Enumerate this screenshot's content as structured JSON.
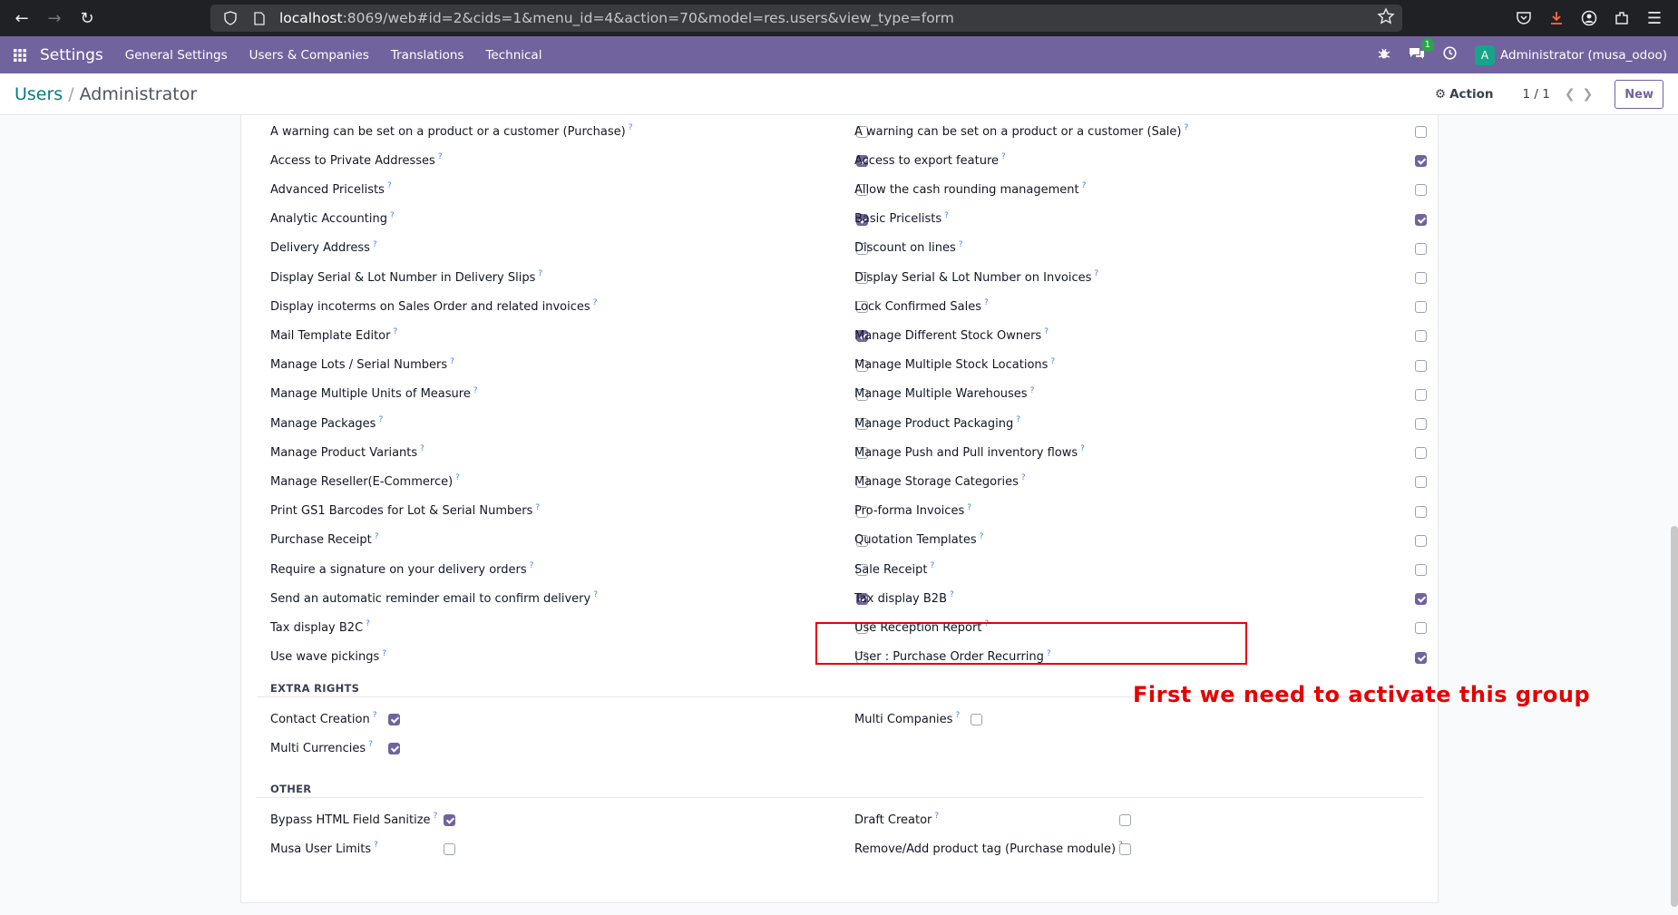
{
  "browser": {
    "url_host": "localhost",
    "url_rest": ":8069/web#id=2&cids=1&menu_id=4&action=70&model=res.users&view_type=form"
  },
  "navbar": {
    "app_name": "Settings",
    "menu": [
      "General Settings",
      "Users & Companies",
      "Translations",
      "Technical"
    ],
    "chat_count": "1",
    "user_initial": "A",
    "user_name": "Administrator (musa_odoo)"
  },
  "control_panel": {
    "breadcrumb_parent": "Users",
    "breadcrumb_current": "Administrator",
    "action_label": "Action",
    "pager": "1 / 1",
    "new_label": "New"
  },
  "permissions": [
    {
      "left": {
        "label": "A warning can be set on a product or a customer (Purchase)",
        "checked": false
      },
      "right": {
        "label": "A warning can be set on a product or a customer (Sale)",
        "checked": false
      }
    },
    {
      "left": {
        "label": "Access to Private Addresses",
        "checked": true
      },
      "right": {
        "label": "Access to export feature",
        "checked": true
      }
    },
    {
      "left": {
        "label": "Advanced Pricelists",
        "checked": false
      },
      "right": {
        "label": "Allow the cash rounding management",
        "checked": false
      }
    },
    {
      "left": {
        "label": "Analytic Accounting",
        "checked": true
      },
      "right": {
        "label": "Basic Pricelists",
        "checked": true
      }
    },
    {
      "left": {
        "label": "Delivery Address",
        "checked": false
      },
      "right": {
        "label": "Discount on lines",
        "checked": false
      }
    },
    {
      "left": {
        "label": "Display Serial & Lot Number in Delivery Slips",
        "checked": false
      },
      "right": {
        "label": "Display Serial & Lot Number on Invoices",
        "checked": false
      }
    },
    {
      "left": {
        "label": "Display incoterms on Sales Order and related invoices",
        "checked": false
      },
      "right": {
        "label": "Lock Confirmed Sales",
        "checked": false
      }
    },
    {
      "left": {
        "label": "Mail Template Editor",
        "checked": true
      },
      "right": {
        "label": "Manage Different Stock Owners",
        "checked": false
      }
    },
    {
      "left": {
        "label": "Manage Lots / Serial Numbers",
        "checked": false
      },
      "right": {
        "label": "Manage Multiple Stock Locations",
        "checked": false
      }
    },
    {
      "left": {
        "label": "Manage Multiple Units of Measure",
        "checked": false
      },
      "right": {
        "label": "Manage Multiple Warehouses",
        "checked": false
      }
    },
    {
      "left": {
        "label": "Manage Packages",
        "checked": false
      },
      "right": {
        "label": "Manage Product Packaging",
        "checked": false
      }
    },
    {
      "left": {
        "label": "Manage Product Variants",
        "checked": false
      },
      "right": {
        "label": "Manage Push and Pull inventory flows",
        "checked": false
      }
    },
    {
      "left": {
        "label": "Manage Reseller(E-Commerce)",
        "checked": false
      },
      "right": {
        "label": "Manage Storage Categories",
        "checked": false
      }
    },
    {
      "left": {
        "label": "Print GS1 Barcodes for Lot & Serial Numbers",
        "checked": false
      },
      "right": {
        "label": "Pro-forma Invoices",
        "checked": false
      }
    },
    {
      "left": {
        "label": "Purchase Receipt",
        "checked": false
      },
      "right": {
        "label": "Quotation Templates",
        "checked": false
      }
    },
    {
      "left": {
        "label": "Require a signature on your delivery orders",
        "checked": false
      },
      "right": {
        "label": "Sale Receipt",
        "checked": false
      }
    },
    {
      "left": {
        "label": "Send an automatic reminder email to confirm delivery",
        "checked": true
      },
      "right": {
        "label": "Tax display B2B",
        "checked": true
      }
    },
    {
      "left": {
        "label": "Tax display B2C",
        "checked": false
      },
      "right": {
        "label": "Use Reception Report",
        "checked": false
      }
    },
    {
      "left": {
        "label": "Use wave pickings",
        "checked": false
      },
      "right": {
        "label": "User : Purchase Order Recurring",
        "checked": true
      }
    }
  ],
  "extra_rights": {
    "title": "EXTRA RIGHTS",
    "items": [
      {
        "label": "Contact Creation",
        "checked": true
      },
      {
        "label": "Multi Companies",
        "checked": false
      },
      {
        "label": "Multi Currencies",
        "checked": true
      }
    ]
  },
  "other": {
    "title": "OTHER",
    "items": [
      {
        "label": "Bypass HTML Field Sanitize",
        "checked": true
      },
      {
        "label": "Draft Creator",
        "checked": false
      },
      {
        "label": "Musa User Limits",
        "checked": false
      },
      {
        "label": "Remove/Add product tag (Purchase module)",
        "checked": false
      }
    ]
  },
  "help_mark": "?",
  "annotation": "First we need to activate this group",
  "colors": {
    "brand": "#71639e",
    "annotation": "#e60000"
  }
}
